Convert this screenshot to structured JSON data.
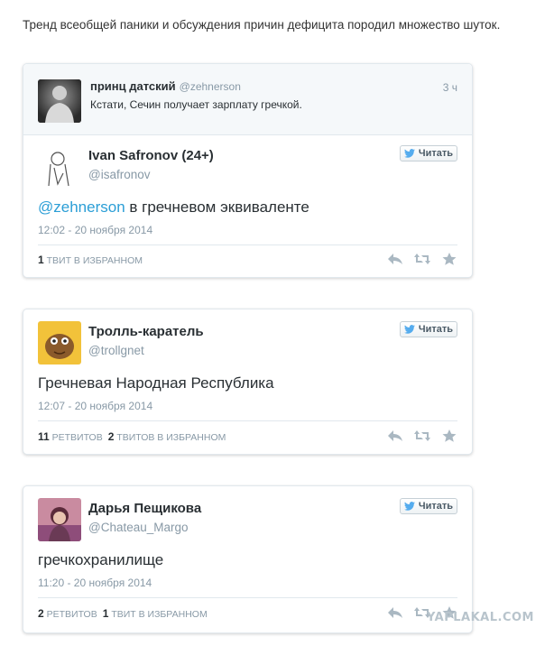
{
  "intro": "Тренд всеобщей паники и обсуждения причин дефицита породил множество шуток.",
  "reply_context": {
    "name": "принц датский",
    "handle": "@zehnerson",
    "time": "3 ч",
    "text": "Кстати, Сечин получает зарплату гречкой."
  },
  "tweets": [
    {
      "name": "Ivan Safronov (24+)",
      "handle": "@isafronov",
      "follow": "Читать",
      "mention": "@zehnerson",
      "text": " в гречневом эквиваленте",
      "date": "12:02 - 20 ноября 2014",
      "stat1_num": "1",
      "stat1_label": "твит в избранном"
    },
    {
      "name": "Тролль-каратель",
      "handle": "@trollgnet",
      "follow": "Читать",
      "text": "Гречневая Народная Республика",
      "date": "12:07 - 20 ноября 2014",
      "stat1_num": "11",
      "stat1_label": "ретвитов",
      "stat2_num": "2",
      "stat2_label": "твитов в избранном"
    },
    {
      "name": "Дарья Пещикова",
      "handle": "@Chateau_Margo",
      "follow": "Читать",
      "text": "гречкохранилище",
      "date": "11:20 - 20 ноября 2014",
      "stat1_num": "2",
      "stat1_label": "ретвитов",
      "stat2_num": "1",
      "stat2_label": "твит в избранном"
    }
  ],
  "watermark": "YAPLAKAL.COM",
  "colors": {
    "link": "#2b9ed6",
    "muted": "#8899a6",
    "border": "#e1e8ed"
  }
}
